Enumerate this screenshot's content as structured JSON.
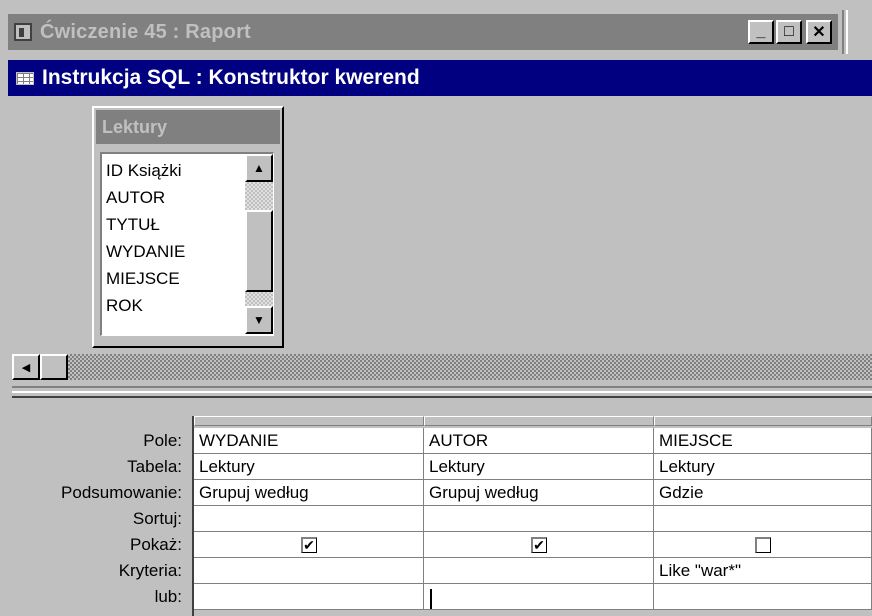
{
  "bg_window": {
    "title": "Ćwiczenie 45 : Raport",
    "icon": "access-form-icon",
    "buttons": {
      "minimize": "_",
      "maximize": "□",
      "close": "✕"
    }
  },
  "child_window": {
    "title": "Instrukcja SQL : Konstruktor kwerend",
    "icon": "query-grid-icon"
  },
  "table_box": {
    "title": "Lektury",
    "fields": [
      "ID Książki",
      "AUTOR",
      "TYTUŁ",
      "WYDANIE",
      "MIEJSCE",
      "ROK"
    ]
  },
  "scroll_glyphs": {
    "up": "▲",
    "down": "▼",
    "left": "◀"
  },
  "grid": {
    "row_labels": [
      "Pole:",
      "Tabela:",
      "Podsumowanie:",
      "Sortuj:",
      "Pokaż:",
      "Kryteria:",
      "lub:"
    ],
    "columns": [
      {
        "pole": "WYDANIE",
        "tabela": "Lektury",
        "podsumowanie": "Grupuj według",
        "sortuj": "",
        "pokaz": "✔",
        "kryteria": "",
        "lub": ""
      },
      {
        "pole": "AUTOR",
        "tabela": "Lektury",
        "podsumowanie": "Grupuj według",
        "sortuj": "",
        "pokaz": "✔",
        "kryteria": "",
        "lub": ""
      },
      {
        "pole": "MIEJSCE",
        "tabela": "Lektury",
        "podsumowanie": "Gdzie",
        "sortuj": "",
        "pokaz": "",
        "kryteria": "Like \"war*\"",
        "lub": ""
      }
    ]
  },
  "colors": {
    "active_title": "#000080",
    "inactive_title": "#808080",
    "face": "#c0c0c0"
  }
}
